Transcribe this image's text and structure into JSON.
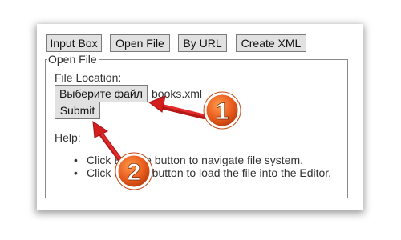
{
  "toolbar": {
    "tabs": [
      {
        "label": "Input Box"
      },
      {
        "label": "Open File"
      },
      {
        "label": "By URL"
      },
      {
        "label": "Create XML"
      }
    ]
  },
  "open_file": {
    "legend": "Open File",
    "file_location_label": "File Location:",
    "choose_file_button": "Выберите файл",
    "selected_file": "books.xml",
    "submit_button": "Submit",
    "help_label": "Help:",
    "help_items": [
      "Click Browse button to navigate file system.",
      "Click Submit button to load the file into the Editor."
    ]
  },
  "annotations": {
    "marker_1": "1",
    "marker_2": "2",
    "arrow_color": "#d41f1f",
    "badge_color": "#e85a1c"
  }
}
